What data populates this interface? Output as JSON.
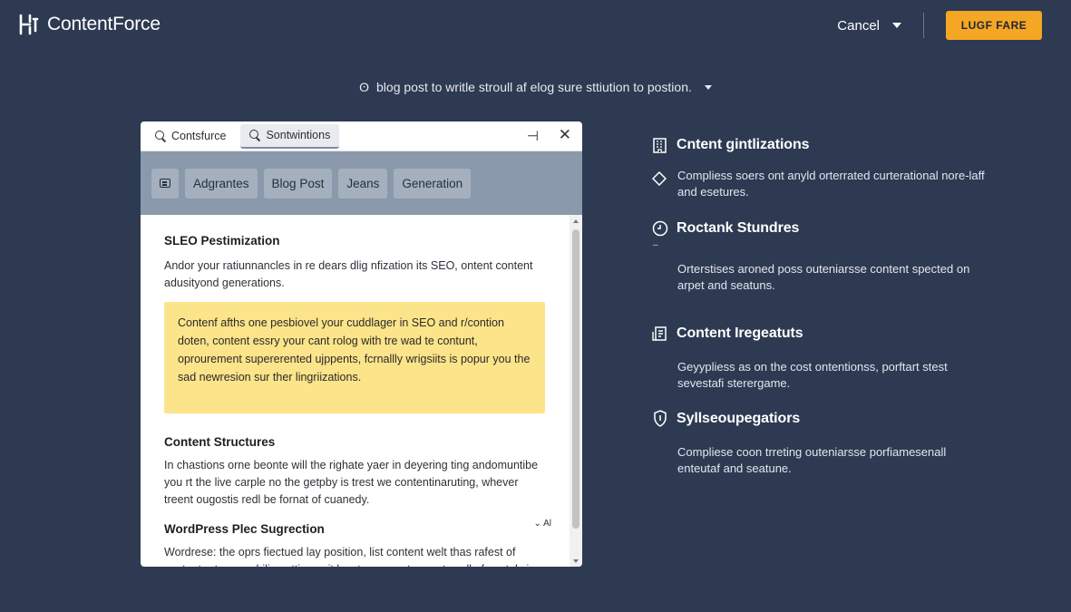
{
  "app": {
    "name": "ContentForce"
  },
  "header": {
    "cancel_label": "Cancel",
    "primary_label": "LUGF FARE"
  },
  "prompt": {
    "icon_char": "ʘ",
    "text": "blog post to writle stroull af elog sure sttiution to postion."
  },
  "card": {
    "tabs": [
      {
        "label": "Contsfurce",
        "active": false
      },
      {
        "label": "Sontwintions",
        "active": true
      }
    ],
    "pin_glyph": "⊣",
    "close_glyph": "✕",
    "toolbar_chips": [
      "Adgrantes",
      "Blog Post",
      "Jeans",
      "Generation"
    ],
    "sections": [
      {
        "title": "SLEO Pestimization",
        "text": "Andor your ratiunnancles in re dears dlig nfization its SEO, ontent content adusityond generations."
      },
      {
        "highlight": "Contenf afths one pesbiovel your cuddlager in SEO and r/contion doten, content essry your cant rolog with tre wad te contunt, oprourement supererented ujppents, fcrnallly wrigsiits is popur you the sad newresion sur ther lingriizations."
      },
      {
        "title": "Content Structures",
        "text": "In chastions orne beonte will the righate yaer in deyering ting andomuntibe you rt the live carple no the getpby is trest we contentinaruting, whever treent ougostis redl be fornat of cuanedy."
      },
      {
        "title": "WordPress Plec Sugrection",
        "more": "⌄ Al",
        "text": "Wordrese: the oprs fiectued lay position, list content welt thas rafest of content artoreveorhilia sottion writ lacatsom ourst eperats soll of contal siy"
      }
    ]
  },
  "features": [
    {
      "icon": "building-icon",
      "title": "Cntent gintlizations",
      "desc": "Compliess soers ont anyld orterrated curterational nore-laff and esetures."
    },
    {
      "icon": "clock-icon",
      "title": "Roctank Stundres",
      "dash": "–",
      "desc": "Orterstises aroned poss outeniarsse content spected on arpet and seatuns."
    },
    {
      "icon": "document-icon",
      "title": "Content Iregeatuts",
      "desc": "Geyypliess as on the cost ontentionss, porftart stest sevestafi sterergame."
    },
    {
      "icon": "shield-icon",
      "title": "Syllseoupegatiors",
      "desc": "Compliese coon trreting outeniarsse porfiamesenall enteutaf and seatune."
    }
  ],
  "colors": {
    "background": "#2e3a52",
    "accent": "#f5a623",
    "highlight": "#fce48a",
    "toolbar": "#8a99ab"
  }
}
